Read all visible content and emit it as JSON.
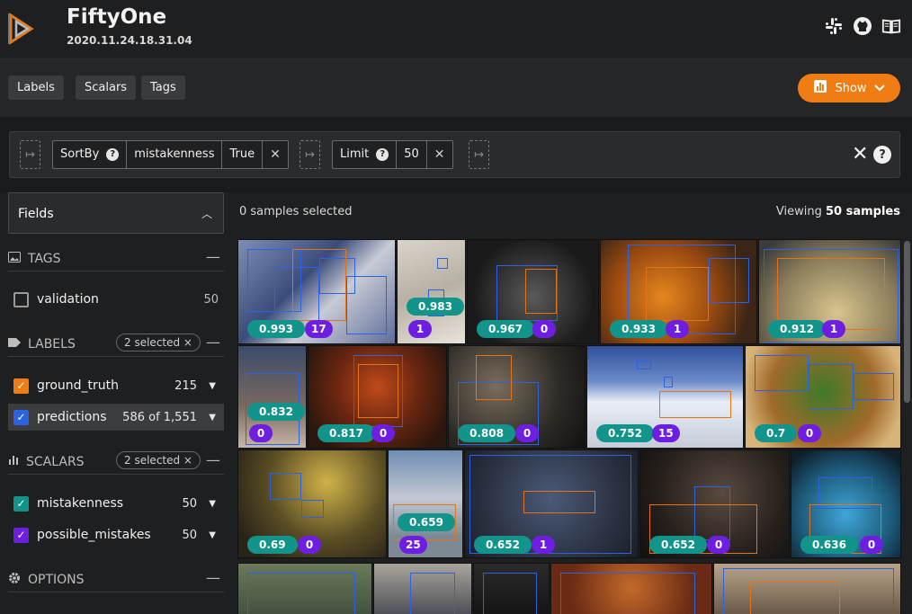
{
  "app": {
    "title": "FiftyOne",
    "subtitle": "2020.11.24.18.31.04"
  },
  "header_icons": [
    "slack-icon",
    "github-icon",
    "docs-book-icon"
  ],
  "tabs": [
    {
      "label": "Labels"
    },
    {
      "label": "Scalars"
    },
    {
      "label": "Tags"
    }
  ],
  "show_button": {
    "label": "Show"
  },
  "view_bar": {
    "stages": [
      {
        "name": "SortBy",
        "params": [
          "mistakenness",
          "True"
        ]
      },
      {
        "name": "Limit",
        "params": [
          "50"
        ]
      }
    ]
  },
  "sidebar": {
    "fields_label": "Fields",
    "tags": {
      "header": "TAGS",
      "items": [
        {
          "label": "validation",
          "count": "50",
          "checked": false
        }
      ]
    },
    "labels": {
      "header": "LABELS",
      "selected": "2 selected ×",
      "items": [
        {
          "label": "ground_truth",
          "count": "215",
          "color": "#f07d13",
          "checked": true
        },
        {
          "label": "predictions",
          "count": "586 of 1,551",
          "color": "#2d63e0",
          "checked": true
        }
      ]
    },
    "scalars": {
      "header": "SCALARS",
      "selected": "2 selected ×",
      "items": [
        {
          "label": "mistakenness",
          "count": "50",
          "color": "#13948a",
          "checked": true
        },
        {
          "label": "possible_mistakes",
          "count": "50",
          "color": "#6d1ee0",
          "checked": true
        }
      ]
    },
    "options": {
      "header": "OPTIONS"
    }
  },
  "grid": {
    "selected_text": "0 samples selected",
    "viewing_prefix": "Viewing",
    "viewing_count": "50 samples",
    "samples": [
      {
        "mistakenness": "0.993",
        "possible_mistakes": "17"
      },
      {
        "mistakenness": "0.983",
        "possible_mistakes": "1"
      },
      {
        "mistakenness": "0.967",
        "possible_mistakes": "0"
      },
      {
        "mistakenness": "0.933",
        "possible_mistakes": "1"
      },
      {
        "mistakenness": "0.912",
        "possible_mistakes": "1"
      },
      {
        "mistakenness": "0.832",
        "possible_mistakes": "0"
      },
      {
        "mistakenness": "0.817",
        "possible_mistakes": "0"
      },
      {
        "mistakenness": "0.808",
        "possible_mistakes": "0"
      },
      {
        "mistakenness": "0.752",
        "possible_mistakes": "15"
      },
      {
        "mistakenness": "0.7",
        "possible_mistakes": "0"
      },
      {
        "mistakenness": "0.69",
        "possible_mistakes": "0"
      },
      {
        "mistakenness": "0.659",
        "possible_mistakes": "25"
      },
      {
        "mistakenness": "0.652",
        "possible_mistakes": "1"
      },
      {
        "mistakenness": "0.652",
        "possible_mistakes": "0"
      },
      {
        "mistakenness": "0.636",
        "possible_mistakes": "0"
      }
    ]
  },
  "colors": {
    "accent": "#f07d13",
    "teal": "#13948a",
    "purple": "#6d1ee0",
    "blue": "#2d63e0"
  }
}
